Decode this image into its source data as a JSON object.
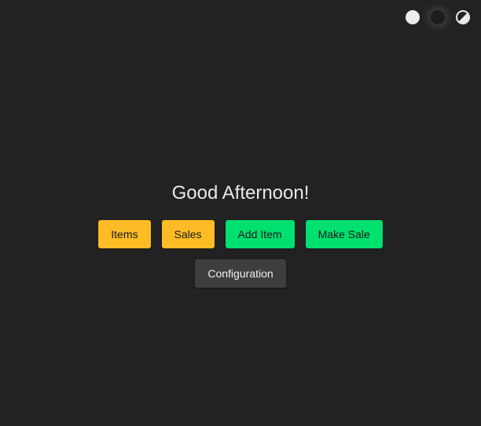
{
  "theme_switcher": {
    "options": [
      {
        "name": "light",
        "color": "#ececec"
      },
      {
        "name": "dark",
        "color": "#1c1c1c"
      },
      {
        "name": "auto",
        "color": "#ececec"
      }
    ]
  },
  "main": {
    "greeting": "Good Afternoon!",
    "buttons": {
      "items": "Items",
      "sales": "Sales",
      "add_item": "Add Item",
      "make_sale": "Make Sale",
      "configuration": "Configuration"
    }
  },
  "colors": {
    "background": "#222222",
    "yellow": "#fdbc25",
    "green": "#00e06f",
    "gray": "#3e3e3e"
  }
}
